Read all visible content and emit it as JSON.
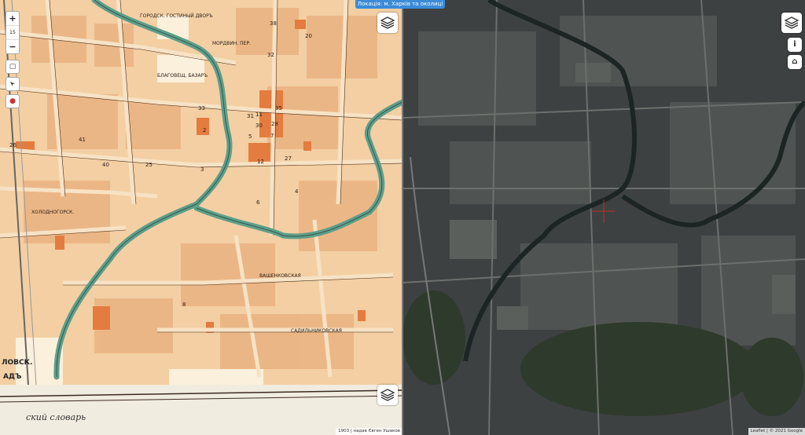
{
  "header": {
    "title": "Локація: м. Харків та околиці"
  },
  "left_map": {
    "zoom": {
      "in_label": "+",
      "level": "15",
      "out_label": "−"
    },
    "labels": {
      "gostiny": "ГОРОДСК. ГОСТИНЫЙ ДВОРЪ",
      "bazar": "БЛАГОВЕЩ. БАЗАРЪ",
      "mordvin": "МОРДВИН. ПЕР.",
      "kholodnogorsk": "ХОЛОДНОГОРСК.",
      "vashenk": "ВАШЕНКОВСКАЯ",
      "sadil": "САДИЛЬНИКОВСКАЯ",
      "lovsk": "ЛОВСК.",
      "ad": "АДЪ",
      "slovar": "ский словарь",
      "numbers": [
        "38",
        "20",
        "32",
        "11",
        "35",
        "26",
        "41",
        "40",
        "25",
        "2",
        "30",
        "27",
        "12",
        "4",
        "3",
        "6",
        "5",
        "7",
        "8",
        "31",
        "33",
        "28"
      ]
    }
  },
  "right_map": {
    "buttons": {
      "info": "i",
      "home": "⌂"
    }
  },
  "attribution": {
    "left": "1903 | надав Євген Ушаков",
    "right": "Leaflet | © 2021 Google"
  },
  "colors": {
    "paper": "#f3cfa3",
    "block": "#eab27e",
    "river": "#5f9e8a",
    "satellite": "#3e4142",
    "pill": "#3b8bd9"
  }
}
